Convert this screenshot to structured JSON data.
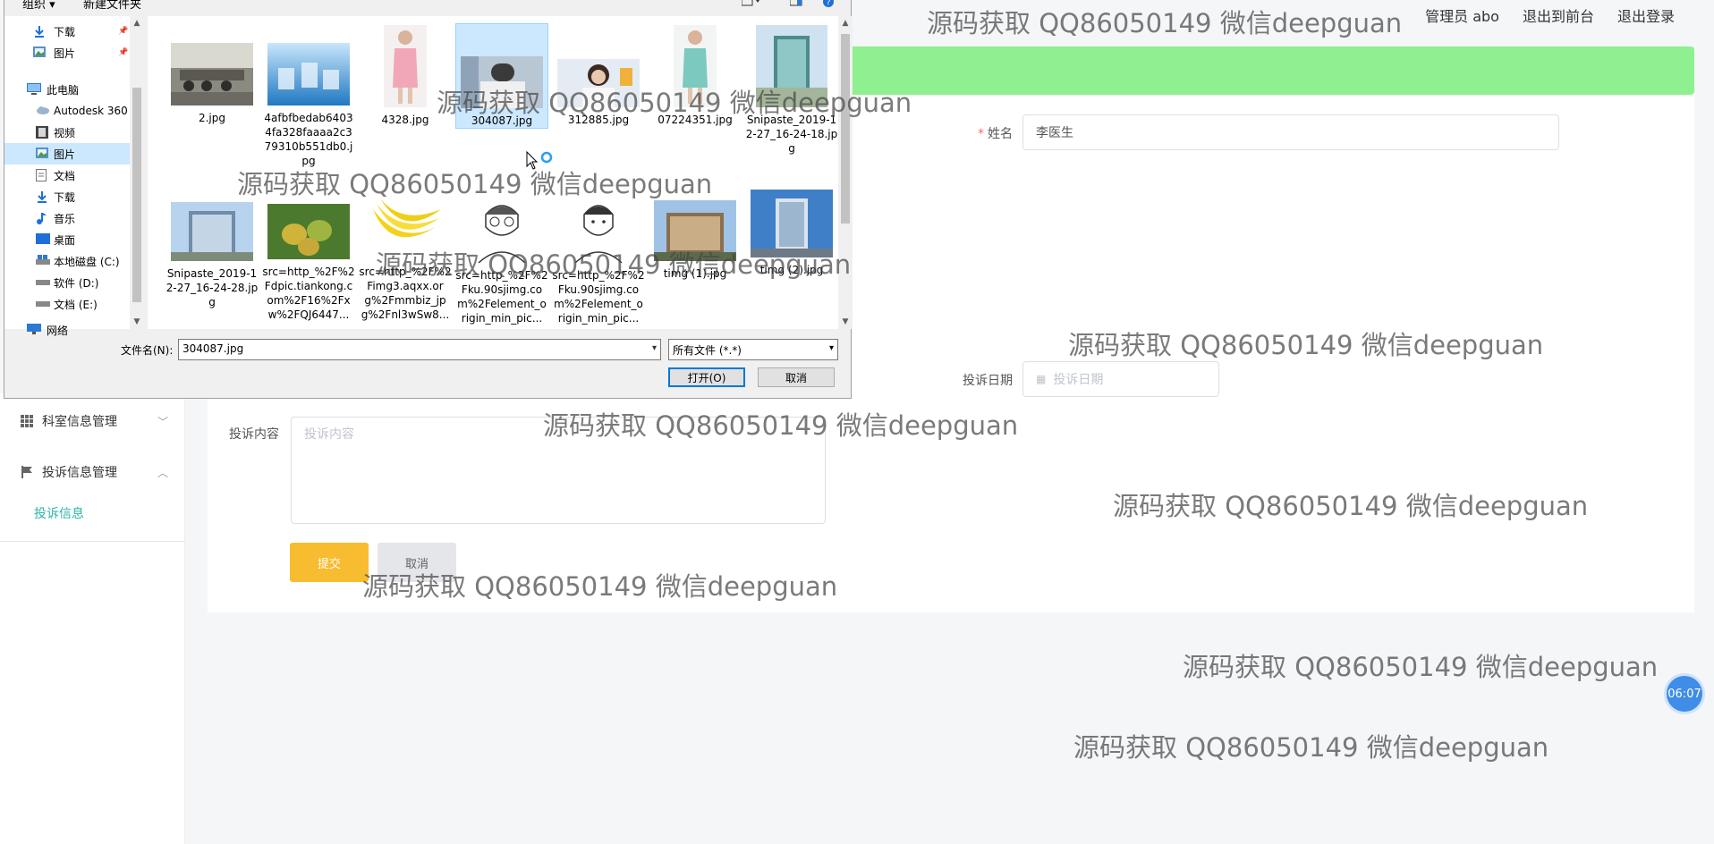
{
  "header": {
    "admin_label": "管理员 abo",
    "front_link": "退出到前台",
    "logout_link": "退出登录"
  },
  "sidebar": {
    "items": [
      {
        "label": "科室信息管理",
        "icon": "grid-icon"
      },
      {
        "label": "投诉信息管理",
        "icon": "flag-icon"
      }
    ],
    "active_sub": "投诉信息"
  },
  "form": {
    "name_label": "姓名",
    "name_value": "李医生",
    "date_label": "投诉日期",
    "date_placeholder": "投诉日期",
    "content_label": "投诉内容",
    "content_placeholder": "投诉内容",
    "submit_label": "提交",
    "cancel_label": "取消"
  },
  "timer": "06:07",
  "dialog": {
    "toolbar": {
      "organize": "组织 ▾",
      "new_folder": "新建文件夹"
    },
    "nav": [
      {
        "label": "下载",
        "icon": "download-icon",
        "pinned": true
      },
      {
        "label": "图片",
        "icon": "pictures-icon",
        "pinned": true
      },
      {
        "label": "此电脑",
        "icon": "computer-icon"
      },
      {
        "label": "Autodesk 360",
        "icon": "cloud-icon"
      },
      {
        "label": "视频",
        "icon": "video-icon"
      },
      {
        "label": "图片",
        "icon": "pictures-icon",
        "selected": true
      },
      {
        "label": "文档",
        "icon": "document-icon"
      },
      {
        "label": "下载",
        "icon": "download-icon"
      },
      {
        "label": "音乐",
        "icon": "music-icon"
      },
      {
        "label": "桌面",
        "icon": "desktop-icon"
      },
      {
        "label": "本地磁盘 (C:)",
        "icon": "drive-icon"
      },
      {
        "label": "软件 (D:)",
        "icon": "drive-icon"
      },
      {
        "label": "文档 (E:)",
        "icon": "drive-icon"
      },
      {
        "label": "网络",
        "icon": "network-icon"
      }
    ],
    "files": [
      {
        "name": "2.jpg",
        "thumb": "classroom-photo"
      },
      {
        "name": "4afbfbedab64034fa328faaaa2c379310b551db0.jpg",
        "thumb": "blue-tech-image"
      },
      {
        "name": "4328.jpg",
        "thumb": "nurse-pink-photo"
      },
      {
        "name": "304087.jpg",
        "thumb": "doctor-photo",
        "selected": true
      },
      {
        "name": "312885.jpg",
        "thumb": "doctor-woman-photo"
      },
      {
        "name": "07224351.jpg",
        "thumb": "nurse-teal-photo"
      },
      {
        "name": "Snipaste_2019-12-27_16-24-18.jpg",
        "thumb": "hospital-tower-photo"
      },
      {
        "name": "Snipaste_2019-12-27_16-24-28.jpg",
        "thumb": "hospital-building-photo"
      },
      {
        "name": "src=http_%2F%2Fdpic.tiankong.com%2F16%2Fxw%2FQJ6447...",
        "thumb": "mango-photo"
      },
      {
        "name": "src=http_%2F%2Fimg3.aqxx.org%2Fmmbiz_jpg%2Fnl3wSw8...",
        "thumb": "banana-photo"
      },
      {
        "name": "src=http_%2F%2Fku.90sjimg.com%2Felement_origin_min_pic...",
        "thumb": "man-glasses-avatar"
      },
      {
        "name": "src=http_%2F%2Fku.90sjimg.com%2Felement_origin_min_pic...",
        "thumb": "man-avatar"
      },
      {
        "name": "timg (1).jpg",
        "thumb": "hospital-photo"
      },
      {
        "name": "timg (2).jpg",
        "thumb": "hospital-blue-photo"
      }
    ],
    "filename_label": "文件名(N):",
    "filename_value": "304087.jpg",
    "filetype_value": "所有文件 (*.*)",
    "open_label": "打开(O)",
    "cancel_label": "取消"
  },
  "watermark": "源码获取 QQ86050149 微信deepguan"
}
